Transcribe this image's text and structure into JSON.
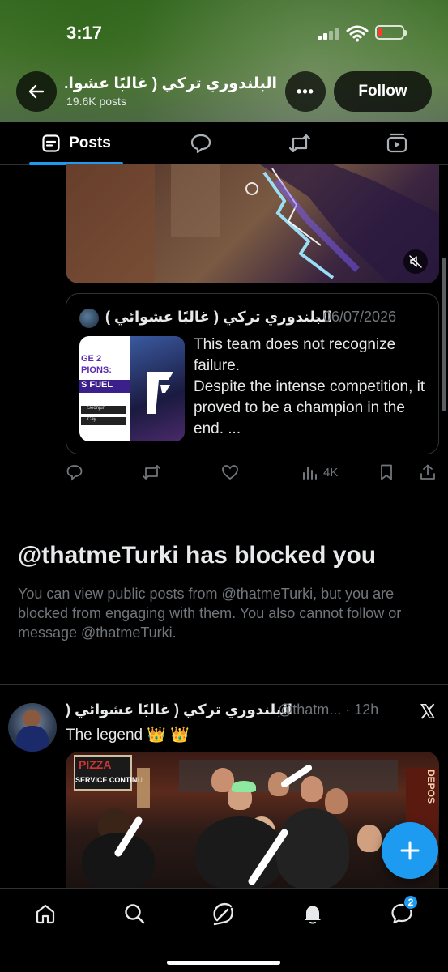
{
  "status_bar": {
    "time": "3:17",
    "battery_color": "#ff3b30"
  },
  "header": {
    "title": "البلندوري تركي ( غالبًا عشوا...",
    "posts_count": "19.6K posts",
    "more_label": "•••",
    "follow_label": "Follow",
    "back_icon": "arrow-left-icon"
  },
  "tabs": [
    {
      "label": "Posts",
      "icon": "posts-icon",
      "active": true
    },
    {
      "label": "",
      "icon": "replies-icon",
      "active": false
    },
    {
      "label": "",
      "icon": "repost-icon",
      "active": false
    },
    {
      "label": "",
      "icon": "media-icon",
      "active": false
    }
  ],
  "quote_tweet": {
    "name": "البلندوري تركي ( غالبًا عشوائي )",
    "date": "· 06/07/2026",
    "text": "This team does not recognize failure.\nDespite the intense competition, it proved to be a champion in the end.  ...",
    "thumb_text_1": "GE 2",
    "thumb_text_2": "PIONS:",
    "thumb_text_3": "S FUEL",
    "thumb_row_1": "Seonjun",
    "thumb_row_2": "Cay"
  },
  "actions": {
    "views": "4K"
  },
  "blocked": {
    "title": "@thatmeTurki has blocked you",
    "body": "You can view public posts from @thatmeTurki, but you are blocked from engaging with them. You also cannot follow or message @thatmeTurki."
  },
  "tweet2": {
    "name": "البلندوري تركي ( غالبًا عشوائي (",
    "handle": "@thatm... · 12h",
    "text": "The legend 👑 👑",
    "sign_text": "PIZZA",
    "sign_sub": "SERVICE CONTINU",
    "right_sign": "DEPOS"
  },
  "fab": {
    "icon": "plus-icon"
  },
  "bottom_nav": {
    "items": [
      "home-icon",
      "search-icon",
      "grok-icon",
      "notifications-icon",
      "messages-icon"
    ],
    "messages_badge": "2"
  },
  "colors": {
    "accent": "#1d9bf0",
    "muted": "#71767b",
    "border": "#2f3336"
  }
}
